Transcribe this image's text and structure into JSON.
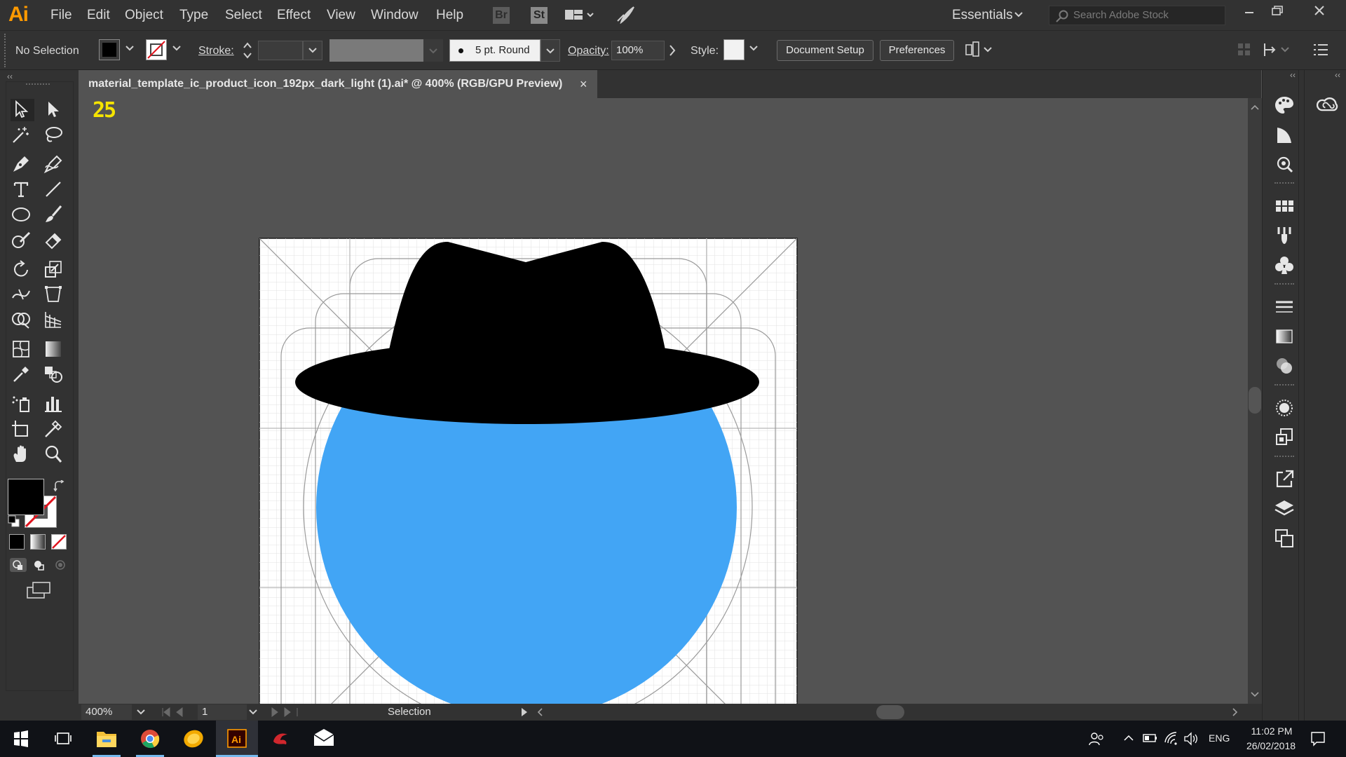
{
  "app": {
    "logo": "Ai",
    "menu": [
      "File",
      "Edit",
      "Object",
      "Type",
      "Select",
      "Effect",
      "View",
      "Window",
      "Help"
    ],
    "bridge_label": "Br",
    "stock_label": "St",
    "workspace": "Essentials",
    "search_placeholder": "Search Adobe Stock"
  },
  "control_bar": {
    "selection_status": "No Selection",
    "stroke_label": "Stroke:",
    "brush": "5 pt. Round",
    "opacity_label": "Opacity:",
    "opacity_value": "100%",
    "style_label": "Style:",
    "document_setup": "Document Setup",
    "preferences": "Preferences"
  },
  "document": {
    "tab_title": "material_template_ic_product_icon_192px_dark_light (1).ai* @ 400% (RGB/GPU Preview)",
    "close_glyph": "×"
  },
  "canvas": {
    "counter": "25"
  },
  "status_bar": {
    "zoom": "400%",
    "artboard_number": "1",
    "tool_name": "Selection"
  },
  "taskbar": {
    "language": "ENG",
    "time": "11:02 PM",
    "date": "26/02/2018"
  },
  "colors": {
    "app_accent": "#ff9a00",
    "hat": "#000000",
    "circle": "#42a5f5",
    "counter": "#f5e400"
  },
  "icons": {
    "tools": [
      "selection-tool",
      "direct-selection-tool",
      "magic-wand-tool",
      "lasso-tool",
      "pen-tool",
      "curvature-tool",
      "type-tool",
      "line-segment-tool",
      "ellipse-tool",
      "paintbrush-tool",
      "shaper-tool",
      "eraser-tool",
      "rotate-tool",
      "scale-tool",
      "width-tool",
      "free-transform-tool",
      "shape-builder-tool",
      "perspective-grid-tool",
      "mesh-tool",
      "gradient-tool",
      "eyedropper-tool",
      "blend-tool",
      "symbol-sprayer-tool",
      "column-graph-tool",
      "artboard-tool",
      "slice-tool",
      "hand-tool",
      "zoom-tool"
    ],
    "panels": [
      "color-icon",
      "color-guide-icon",
      "libraries-icon",
      "swatches-icon",
      "brushes-icon",
      "symbols-icon",
      "stroke-icon",
      "gradient-icon",
      "transparency-icon",
      "appearance-icon",
      "graphic-styles-icon",
      "export-icon",
      "layers-icon",
      "artboards-icon",
      "creative-cloud-icon"
    ]
  }
}
